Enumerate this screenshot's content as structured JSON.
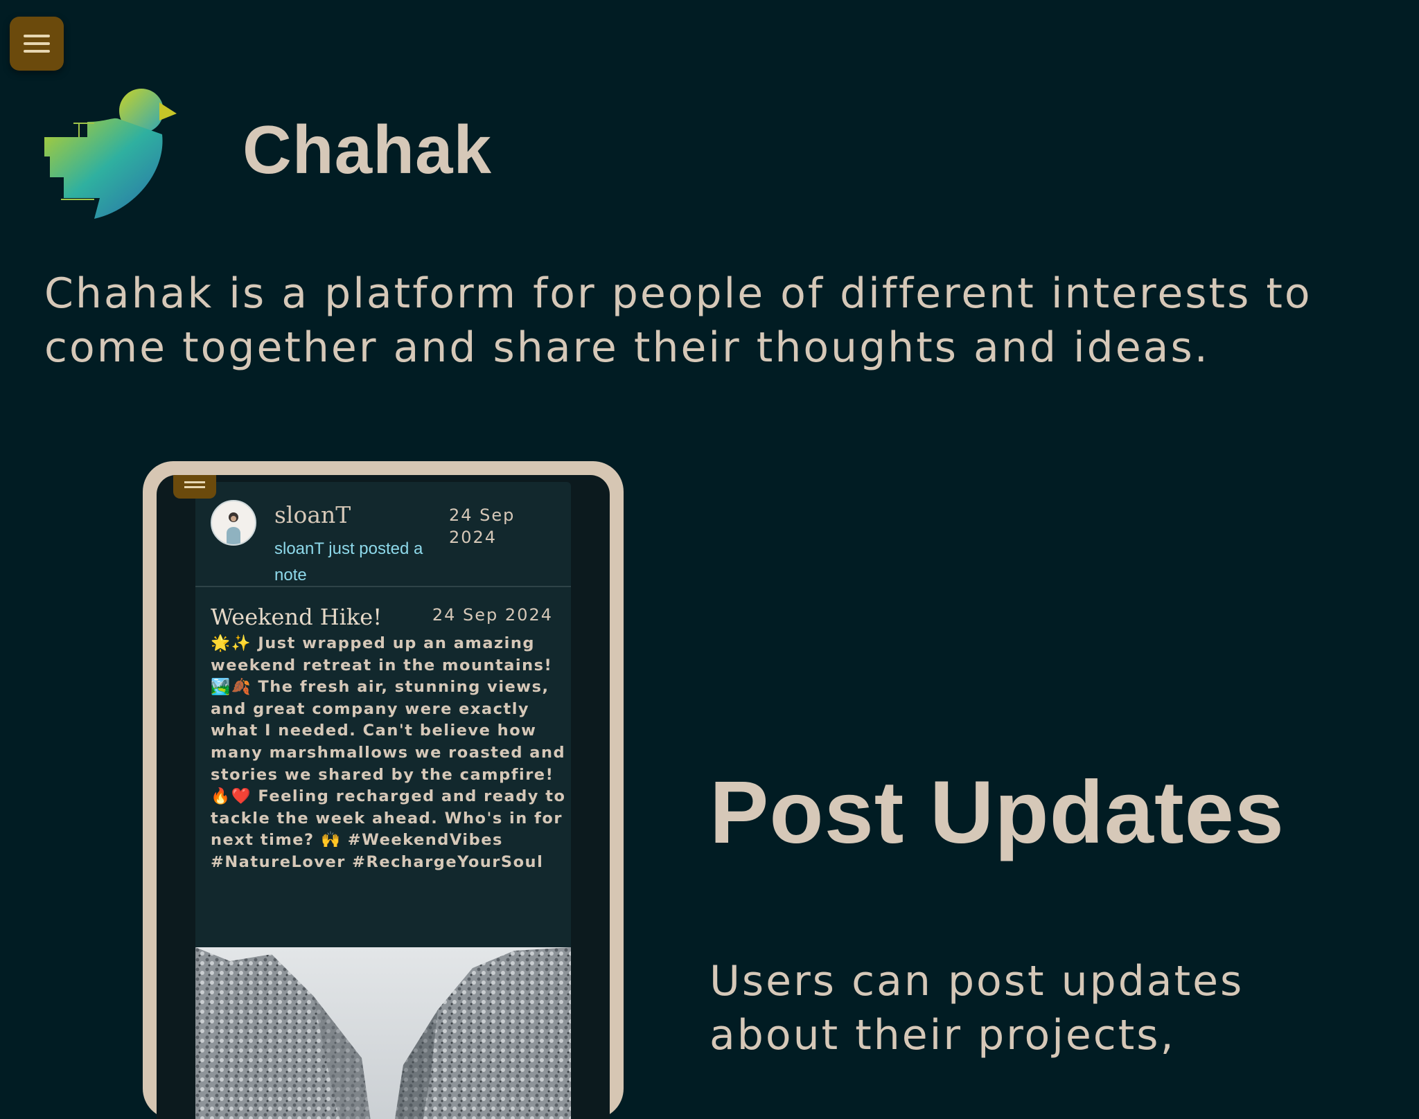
{
  "app": {
    "title": "Chahak",
    "tagline": "Chahak is a platform for people of different interests to come together and share their thoughts and ideas."
  },
  "icons": {
    "menu": "hamburger-menu-icon",
    "logo": "bird-logo"
  },
  "colors": {
    "background": "#011c23",
    "text": "#d6c8b8",
    "menu_button": "#6b4a0c",
    "activity_text": "#8ed9ea"
  },
  "preview": {
    "post": {
      "username": "sloanT",
      "activity": "sloanT just posted a note",
      "date": "24 Sep 2024"
    },
    "note": {
      "title": "Weekend Hike!",
      "date": "24 Sep 2024",
      "body": "🌟✨ Just wrapped up an amazing weekend retreat in the mountains! 🏞️🍂 The fresh air, stunning views, and great company were exactly what I needed. Can't believe how many marshmallows we roasted and stories we shared by the campfire! 🔥❤️ Feeling recharged and ready to tackle the week ahead. Who's in for next time? 🙌 #WeekendVibes #NatureLover #RechargeYourSoul"
    }
  },
  "feature": {
    "title": "Post Updates",
    "description": "Users can post updates about their projects,"
  }
}
